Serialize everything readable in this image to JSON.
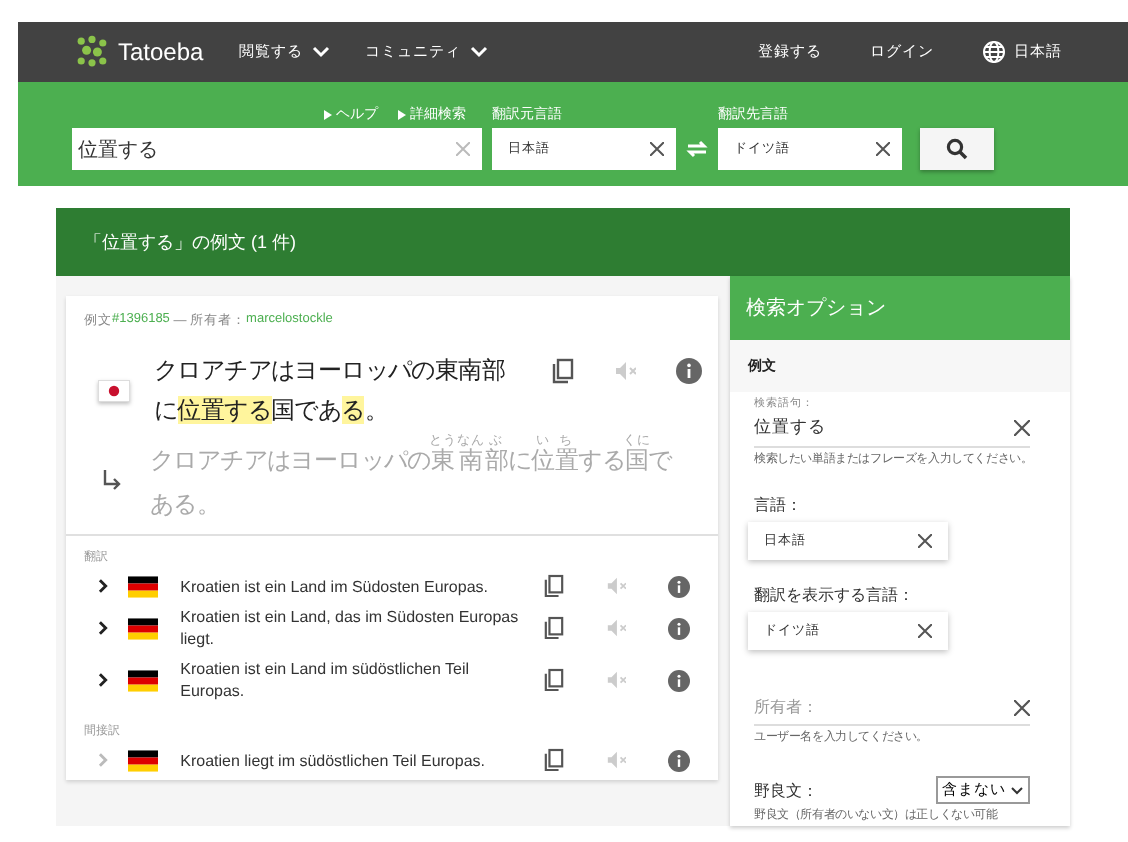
{
  "nav": {
    "brand": "Tatoeba",
    "menus": [
      {
        "label": "閲覧する"
      },
      {
        "label": "コミュニティ"
      }
    ],
    "links": [
      "登録する",
      "ログイン"
    ],
    "language": "日本語"
  },
  "search": {
    "links": [
      "ヘルプ",
      "詳細検索"
    ],
    "query": "位置する",
    "from_label": "翻訳元言語",
    "from": "日本語",
    "to_label": "翻訳先言語",
    "to": "ドイツ語"
  },
  "results_title": "「位置する」の例文 (1 件)",
  "sentence": {
    "label": "例文",
    "id": "#1396185",
    "owner_label": "— 所有者：",
    "owner": "marcelostockle",
    "segments": [
      {
        "text": "クロアチアはヨーロッパの東南部に",
        "highlight": false
      },
      {
        "text": "位置する",
        "highlight": true
      },
      {
        "text": "国であ",
        "highlight": false
      },
      {
        "text": "る",
        "highlight": true
      },
      {
        "text": "。",
        "highlight": false
      }
    ],
    "reading": [
      {
        "text": "クロアチアはヨーロッパの"
      },
      {
        "text": "東南",
        "ruby": "とうなん"
      },
      {
        "text": "部",
        "ruby": "ぶ"
      },
      {
        "text": "に"
      },
      {
        "text": "位置",
        "ruby": "いち"
      },
      {
        "text": "する"
      },
      {
        "text": "国",
        "ruby": "くに"
      },
      {
        "text": "である。"
      }
    ]
  },
  "groups": [
    {
      "label": "翻訳",
      "translations": [
        {
          "kind": "direct",
          "text": "Kroatien ist ein Land im Südosten Europas."
        },
        {
          "kind": "direct",
          "text": "Kroatien ist ein Land, das im Südosten Europas liegt."
        },
        {
          "kind": "direct",
          "text": "Kroatien ist ein Land im südöstlichen Teil Europas."
        }
      ]
    },
    {
      "label": "間接訳",
      "translations": [
        {
          "kind": "indirect",
          "text": "Kroatien liegt im südöstlichen Teil Europas."
        }
      ]
    }
  ],
  "options": {
    "title": "検索オプション",
    "section": "例文",
    "query_label": "検索語句：",
    "query": "位置する",
    "query_hint": "検索したい単語またはフレーズを入力してください。",
    "lang_label": "言語：",
    "lang": "日本語",
    "trans_label": "翻訳を表示する言語：",
    "trans": "ドイツ語",
    "owner_placeholder": "所有者：",
    "owner_hint": "ユーザー名を入力してください。",
    "orphan_label": "野良文：",
    "orphan_value": "含まない",
    "orphan_hint": "野良文（所有者のいない文）は正しくない可能"
  }
}
